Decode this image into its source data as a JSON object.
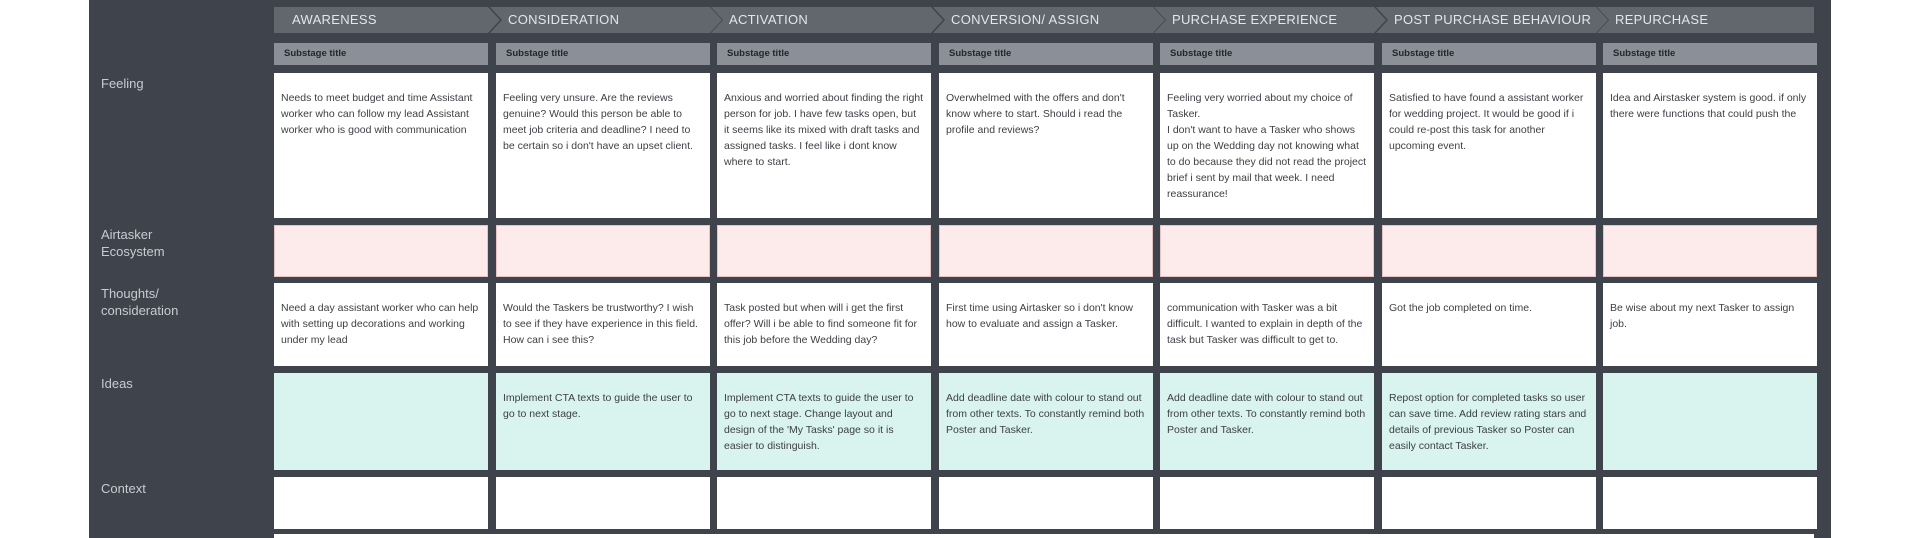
{
  "stages": [
    "AWARENESS",
    "CONSIDERATION",
    "ACTIVATION",
    "CONVERSION/ ASSIGN",
    "PURCHASE EXPERIENCE",
    "POST PURCHASE BEHAVIOUR",
    "REPURCHASE"
  ],
  "substage_title": "Substage title",
  "rows": [
    {
      "label": "Feeling",
      "cells": [
        "Needs to meet budget and time Assistant worker who can follow my lead Assistant worker who is good with communication",
        "Feeling very unsure. Are the reviews genuine? Would this person be able to meet job criteria and deadline? I need to be certain so i don't have an upset client.",
        "Anxious and worried about finding the right person for job.  I have few tasks open, but it seems like its mixed with draft tasks and assigned tasks. I feel like i dont know where to start.",
        "Overwhelmed with the offers and don't know where to start. Should i read the profile and reviews?",
        "Feeling very worried about my choice of Tasker.\nI don't want to have a Tasker who shows up on the Wedding day not knowing what to do because they did not read the project brief i sent by mail that week. I need reassurance!",
        "Satisfied to have found a assistant worker for wedding project. It would be good if i could re-post this task for another upcoming event.",
        "Idea and Airstasker system is good. if only there were functions that could push the"
      ]
    },
    {
      "label": "Airtasker\nEcosystem",
      "cells": [
        "",
        "",
        "",
        "",
        "",
        "",
        ""
      ]
    },
    {
      "label": "Thoughts/\nconsideration",
      "cells": [
        "Need a day assistant worker who can help with setting up decorations and working under my lead",
        "Would the Taskers be trustworthy? I wish to see if they have experience in this field. How can i see this?",
        "Task posted but when will i get the first offer? Will i be able to find someone fit for this job before the Wedding day?",
        "First time using Airtasker so i don't know how to evaluate and assign a Tasker.",
        "communication with Tasker was a bit difficult. I wanted to explain in depth of the task but Tasker was difficult to get to.",
        "Got the job completed on time.",
        "Be wise about my next Tasker to assign job."
      ]
    },
    {
      "label": "Ideas",
      "cells": [
        "",
        "Implement CTA texts to guide the user to go to next stage.",
        "Implement CTA texts to guide the user to go to next stage. Change layout and design of the 'My Tasks' page so it is easier to distinguish.",
        "Add deadline date with colour to stand out from other texts. To constantly remind both Poster and Tasker.",
        "Add deadline date with colour to stand out from other texts. To constantly remind both Poster and Tasker.",
        "Repost option for completed tasks so user can save time. Add review rating stars and details of previous Tasker so Poster can easily contact Tasker.",
        ""
      ]
    },
    {
      "label": "Context",
      "cells": [
        "",
        "",
        "",
        "",
        "",
        "",
        ""
      ]
    }
  ]
}
